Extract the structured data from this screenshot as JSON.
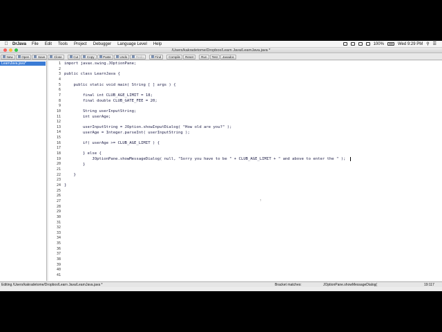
{
  "menubar": {
    "app_name": "DrJava",
    "items": [
      "File",
      "Edit",
      "Tools",
      "Project",
      "Debugger",
      "Language Level",
      "Help"
    ],
    "battery": "100%",
    "clock": "Wed 9:29 PM"
  },
  "window": {
    "title": "/Users/kakradetome/Dropbox/Learn Java/LearnJava.java *"
  },
  "toolbar": {
    "new": "New",
    "open": "Open",
    "save": "Save",
    "close": "Close",
    "cut": "Cut",
    "copy": "Copy",
    "paste": "Paste",
    "undo": "Undo",
    "redo": "Redo",
    "find": "Find",
    "compile": "Compile",
    "reset": "Reset",
    "run": "Run",
    "test": "Test",
    "javadoc": "Javadoc"
  },
  "sidebar": {
    "files": [
      "LearnJava.java*"
    ]
  },
  "editor": {
    "line_numbers": [
      "1",
      "2",
      "3",
      "4",
      "5",
      "6",
      "7",
      "8",
      "9",
      "10",
      "11",
      "12",
      "13",
      "14",
      "15",
      "16",
      "17",
      "18",
      "19",
      "20",
      "21",
      "22",
      "23",
      "24",
      "25",
      "26",
      "27",
      "28",
      "29",
      "30",
      "31",
      "32",
      "33",
      "34",
      "35",
      "36",
      "37",
      "38",
      "39",
      "40",
      "41"
    ],
    "lines": {
      "l1": "import javax.swing.JOptionPane;",
      "l3": "public class LearnJava {",
      "l5": "    public static void main( String [ ] args ) {",
      "l7": "        final int CLUB_AGE_LIMIT = 18;",
      "l8": "        final double CLUB_GATE_FEE = 20;",
      "l10": "        String userInputString;",
      "l11": "        int userAge;",
      "l13": "        userInputString = JOption.showInputDialog( \"How old are you?\" );",
      "l14": "        userAge = Integer.parseInt( userInputString );",
      "l16": "        if( userAge >= CLUB_AGE_LIMIT ) {",
      "l18": "        } else {",
      "l19": "            JOptionPane.showMessageDialog( null, \"Sorry you have to be \" + CLUB_AGE_LIMIT + \" and above to enter the \" );",
      "l20": "        }",
      "l22": "    }",
      "l24": "}"
    }
  },
  "statusbar": {
    "editing": "Editing /Users/kakradetome/Dropbox/Learn Java/LearnJava.java *",
    "bracket_label": "Bracket matches:",
    "bracket_value": "JOptionPane.showMessageDialog(",
    "position": "19:117"
  }
}
